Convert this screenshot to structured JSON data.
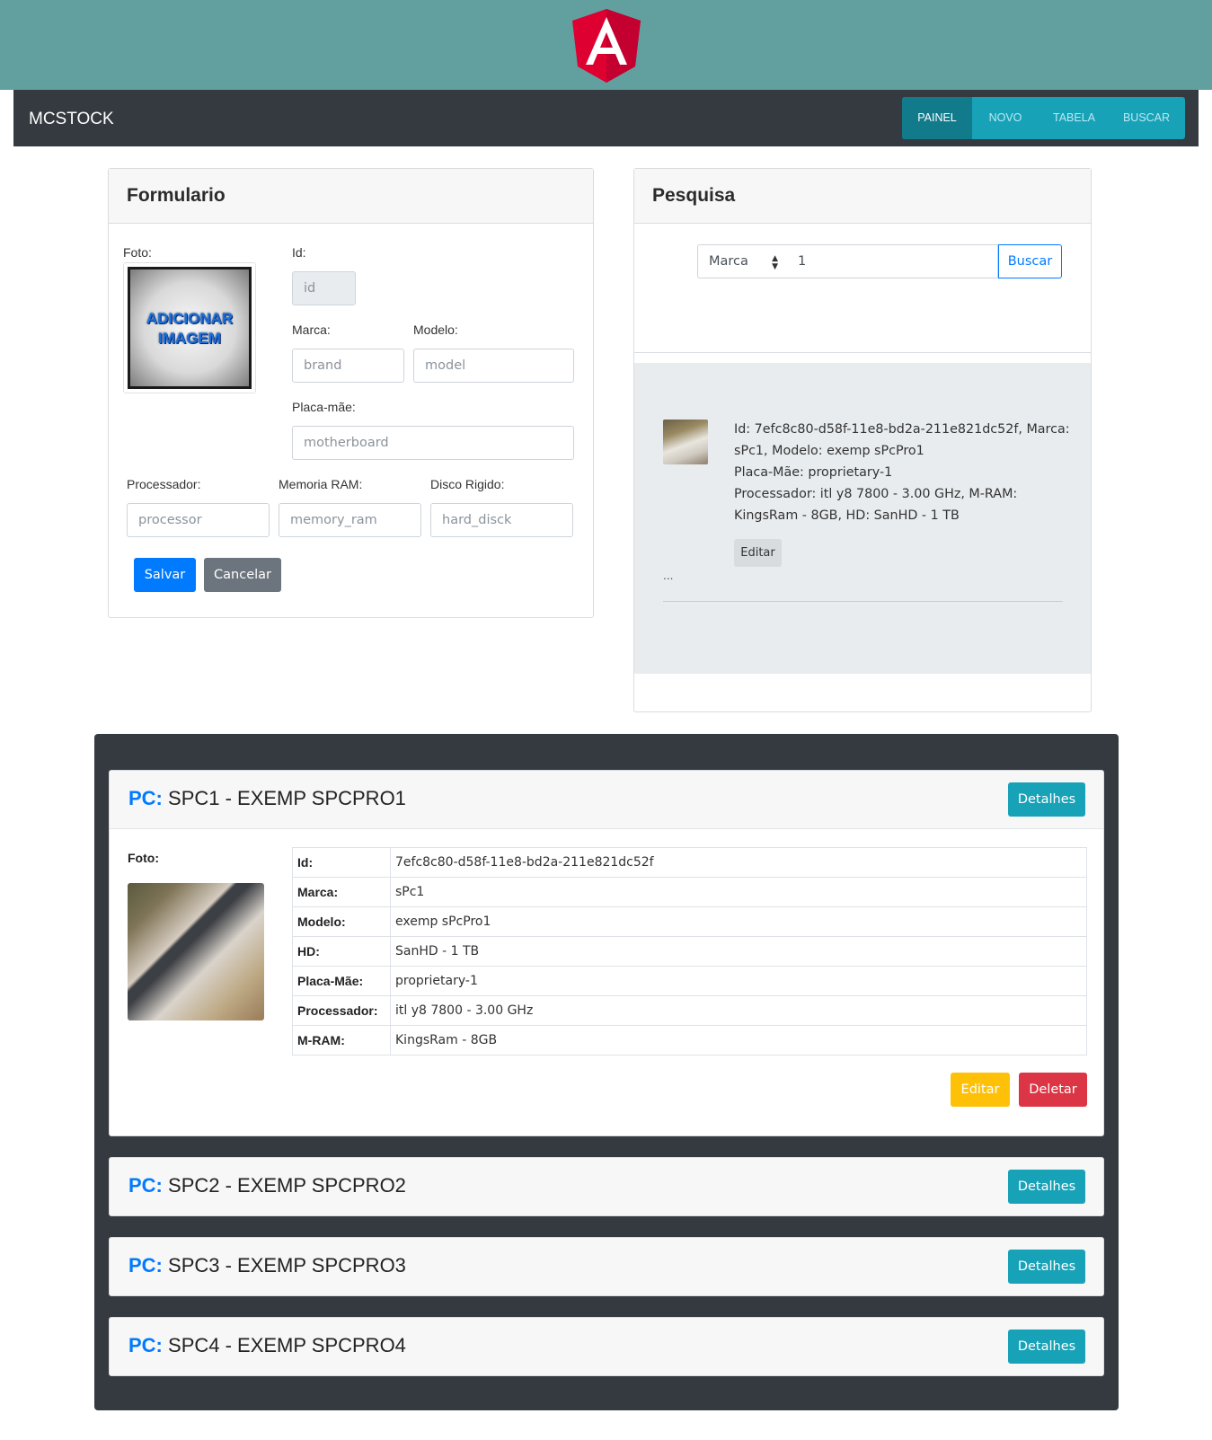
{
  "app": {
    "brand": "MCSTOCK"
  },
  "nav": {
    "items": [
      "PAINEL",
      "NOVO",
      "TABELA",
      "BUSCAR"
    ],
    "active": "PAINEL"
  },
  "form": {
    "title": "Formulario",
    "photo_label": "Foto:",
    "photo_placeholder_line1": "ADICIONAR",
    "photo_placeholder_line2": "IMAGEM",
    "id_label": "Id:",
    "id_placeholder": "id",
    "brand_label": "Marca:",
    "brand_placeholder": "brand",
    "model_label": "Modelo:",
    "model_placeholder": "model",
    "motherboard_label": "Placa-mãe:",
    "motherboard_placeholder": "motherboard",
    "processor_label": "Processador:",
    "processor_placeholder": "processor",
    "memory_label": "Memoria RAM:",
    "memory_placeholder": "memory_ram",
    "hd_label": "Disco Rigido:",
    "hd_placeholder": "hard_disck",
    "save_label": "Salvar",
    "cancel_label": "Cancelar"
  },
  "search": {
    "title": "Pesquisa",
    "field_selected": "Marca",
    "query": "1",
    "button_label": "Buscar",
    "result": {
      "line1": "Id: 7efc8c80-d58f-11e8-bd2a-211e821dc52f, Marca:",
      "line2": "sPc1, Modelo: exemp sPcPro1",
      "line3": "Placa-Mãe: proprietary-1",
      "line4": "Processador: itl y8 7800 - 3.00 GHz, M-RAM:",
      "line5": "KingsRam - 8GB, HD: SanHD - 1 TB",
      "edit_label": "Editar",
      "ellipsis": "..."
    }
  },
  "pcs": {
    "prefix": "PC:",
    "details_label": "Detalhes",
    "items": [
      {
        "title": "SPC1 - EXEMP SPCPRO1"
      },
      {
        "title": "SPC2 - EXEMP SPCPRO2"
      },
      {
        "title": "SPC3 - EXEMP SPCPRO3"
      },
      {
        "title": "SPC4 - EXEMP SPCPRO4"
      }
    ],
    "expanded": {
      "photo_label": "Foto:",
      "rows": [
        {
          "key": "Id:",
          "value": "7efc8c80-d58f-11e8-bd2a-211e821dc52f"
        },
        {
          "key": "Marca:",
          "value": "sPc1"
        },
        {
          "key": "Modelo:",
          "value": "exemp sPcPro1"
        },
        {
          "key": "HD:",
          "value": "SanHD - 1 TB"
        },
        {
          "key": "Placa-Mãe:",
          "value": "proprietary-1"
        },
        {
          "key": "Processador:",
          "value": "itl y8 7800 - 3.00 GHz"
        },
        {
          "key": "M-RAM:",
          "value": "KingsRam - 8GB"
        }
      ],
      "edit_label": "Editar",
      "delete_label": "Deletar"
    }
  },
  "colors": {
    "banner": "#62a0a0",
    "navbar": "#343a40",
    "primary": "#007bff",
    "info": "#17a2b8",
    "warning": "#ffc107",
    "danger": "#dc3545",
    "angular_red": "#dd0031"
  }
}
